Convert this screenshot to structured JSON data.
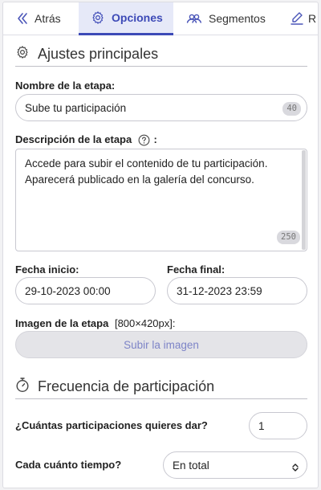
{
  "tabs": [
    {
      "label": "Atrás",
      "icon": "double-chevron-left-icon",
      "active": false
    },
    {
      "label": "Opciones",
      "icon": "gear-icon",
      "active": true
    },
    {
      "label": "Segmentos",
      "icon": "users-group-icon",
      "active": false
    },
    {
      "label": "R",
      "icon": "pen-icon",
      "active": false
    }
  ],
  "main_settings": {
    "title": "Ajustes principales",
    "stage_name_label": "Nombre de la etapa:",
    "stage_name_value": "Sube tu participación",
    "stage_name_counter": "40",
    "description_label": "Descripción de la etapa",
    "description_suffix": ":",
    "description_value": "Accede para subir el contenido de tu participación. Aparecerá publicado en la galería del concurso.",
    "description_counter": "250",
    "start_date_label": "Fecha inicio:",
    "start_date_value": "29-10-2023 00:00",
    "end_date_label": "Fecha final:",
    "end_date_value": "31-12-2023 23:59",
    "image_label": "Imagen de la etapa",
    "image_size_hint": "[800×420px]:",
    "upload_button": "Subir la imagen"
  },
  "frequency": {
    "title": "Frecuencia de participación",
    "count_label": "¿Cuántas participaciones quieres dar?",
    "count_value": "1",
    "period_label": "Cada cuánto tiempo?",
    "period_value": "En total"
  },
  "colors": {
    "accent": "#3d4ab7",
    "active_tab_bg": "#e6e9f8",
    "disabled_button_bg": "#e4e4e8"
  }
}
